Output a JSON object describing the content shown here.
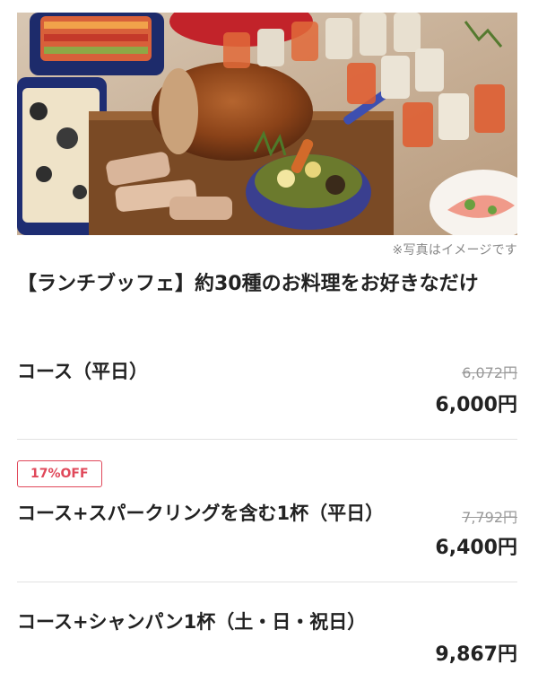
{
  "hero": {
    "caption": "※写真はイメージです"
  },
  "plan": {
    "title": "【ランチブッフェ】約30種のお料理をお好きなだけ"
  },
  "courses": [
    {
      "name": "コース（平日）",
      "original_price": "6,072円",
      "price": "6,000円",
      "badge": ""
    },
    {
      "name": "コース+スパークリングを含む1杯（平日）",
      "original_price": "7,792円",
      "price": "6,400円",
      "badge": "17%OFF"
    },
    {
      "name": "コース+シャンパン1杯（土・日・祝日）",
      "original_price": "",
      "price": "9,867円",
      "badge": ""
    }
  ],
  "colors": {
    "badge_accent": "#e0485a",
    "text_main": "#222222",
    "text_muted": "#999999"
  }
}
